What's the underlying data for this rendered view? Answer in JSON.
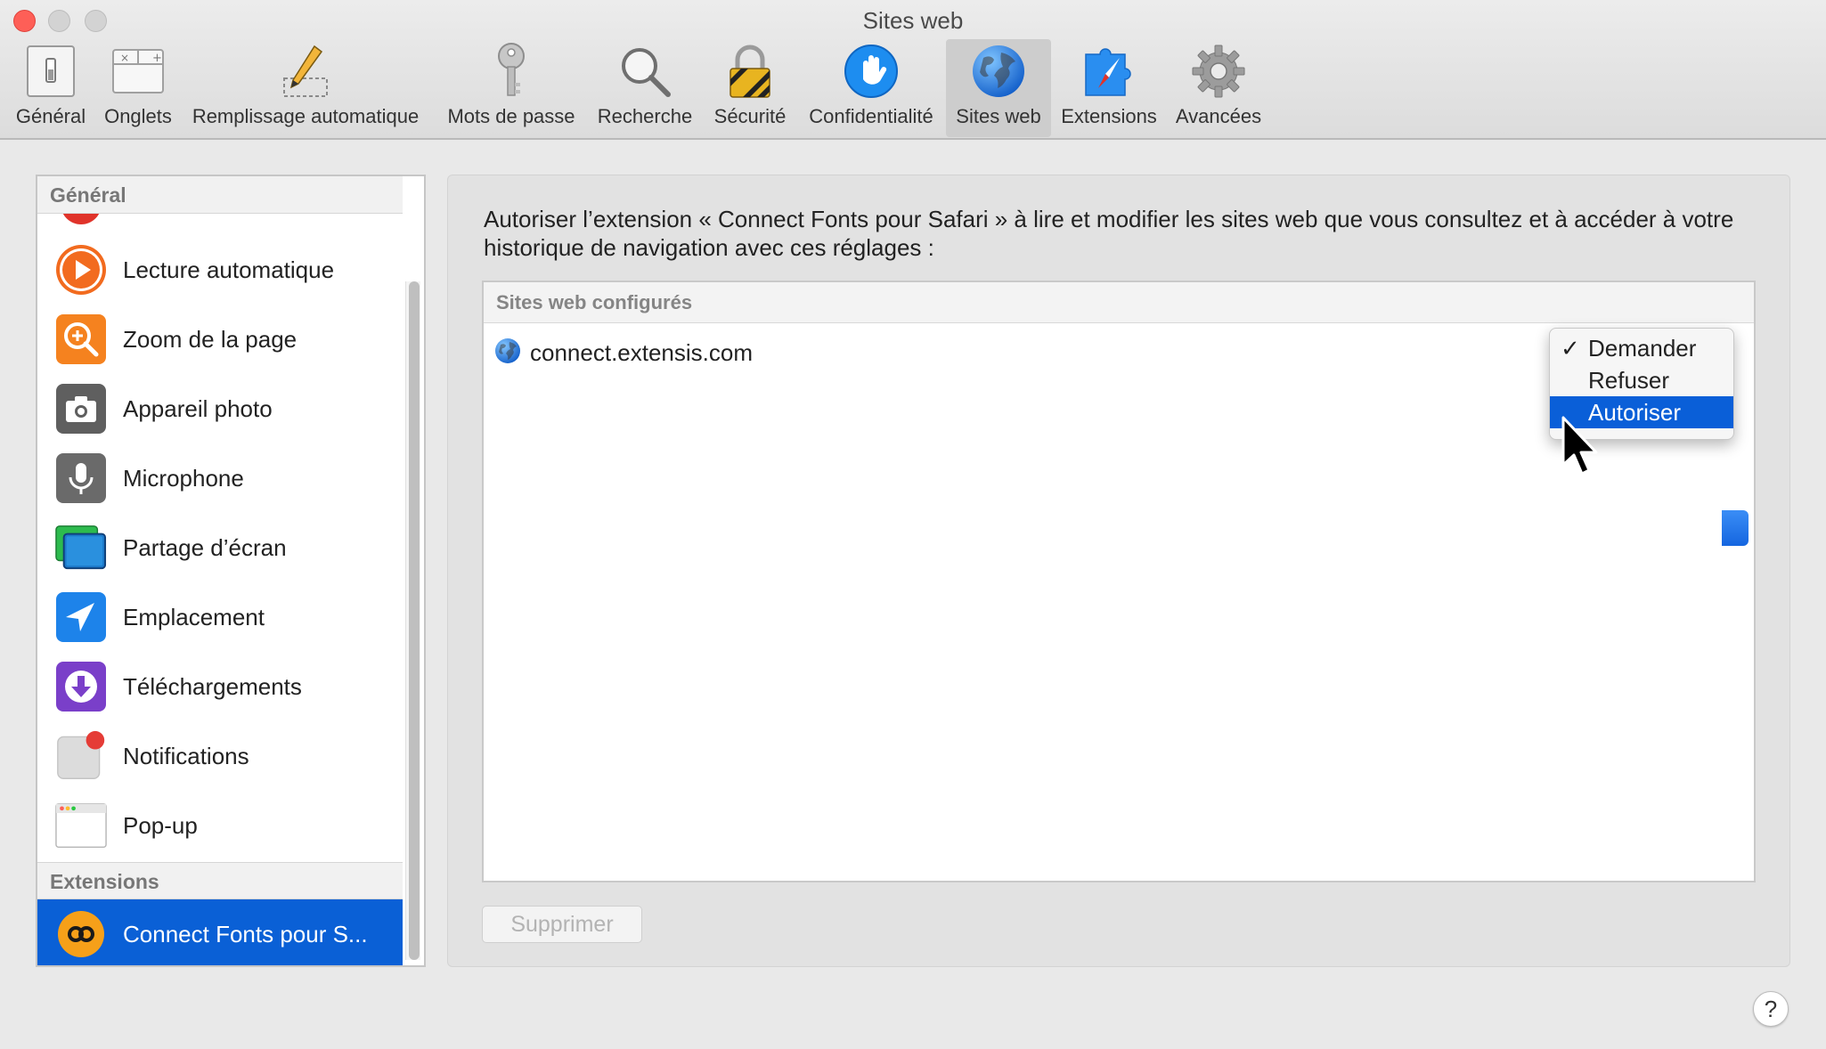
{
  "window": {
    "title": "Sites web"
  },
  "toolbar": {
    "tabs": [
      {
        "label": "Général",
        "icon": "general-switch-icon"
      },
      {
        "label": "Onglets",
        "icon": "tabs-icon"
      },
      {
        "label": "Remplissage automatique",
        "icon": "pencil-autofill-icon"
      },
      {
        "label": "Mots de passe",
        "icon": "key-icon"
      },
      {
        "label": "Recherche",
        "icon": "magnifier-icon"
      },
      {
        "label": "Sécurité",
        "icon": "padlock-icon"
      },
      {
        "label": "Confidentialité",
        "icon": "hand-icon"
      },
      {
        "label": "Sites web",
        "icon": "globe-icon",
        "active": true
      },
      {
        "label": "Extensions",
        "icon": "puzzle-compass-icon"
      },
      {
        "label": "Avancées",
        "icon": "gear-icon"
      }
    ]
  },
  "sidebar": {
    "general_header": "Général",
    "items": [
      {
        "label": "Lecture automatique",
        "icon": "autoplay-icon"
      },
      {
        "label": "Zoom de la page",
        "icon": "zoom-icon"
      },
      {
        "label": "Appareil photo",
        "icon": "camera-icon"
      },
      {
        "label": "Microphone",
        "icon": "microphone-icon"
      },
      {
        "label": "Partage d’écran",
        "icon": "screen-sharing-icon"
      },
      {
        "label": "Emplacement",
        "icon": "location-icon"
      },
      {
        "label": "Téléchargements",
        "icon": "downloads-icon"
      },
      {
        "label": "Notifications",
        "icon": "notifications-icon"
      },
      {
        "label": "Pop-up",
        "icon": "popup-window-icon"
      }
    ],
    "extensions_header": "Extensions",
    "extension_item": {
      "label": "Connect Fonts pour S...",
      "icon": "connect-fonts-icon",
      "selected": true
    }
  },
  "main": {
    "description": "Autoriser l’extension « Connect Fonts pour Safari » à lire et modifier les sites web que vous consultez et à accéder à votre historique de navigation avec ces réglages :",
    "table_header": "Sites web configurés",
    "sites": [
      {
        "domain": "connect.extensis.com",
        "icon": "globe-icon"
      }
    ],
    "permission_menu": {
      "options": [
        "Demander",
        "Refuser",
        "Autoriser"
      ],
      "checked": "Demander",
      "highlighted": "Autoriser",
      "check_mark": "✓"
    },
    "delete_button": "Supprimer",
    "help_button": "?"
  },
  "colors": {
    "accent": "#0a60d6",
    "close_button": "#fe5f57",
    "sidebar_header_text": "#777777"
  }
}
